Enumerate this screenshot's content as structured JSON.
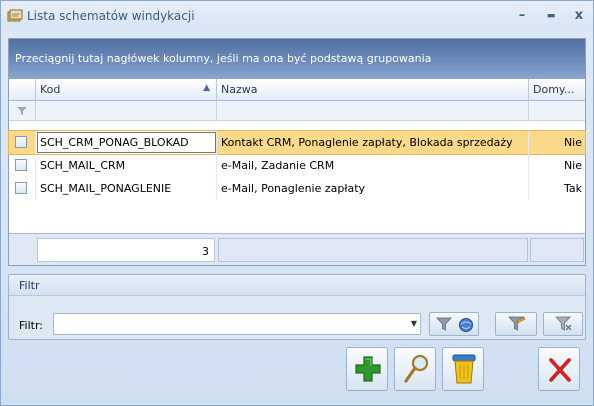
{
  "window": {
    "title": "Lista schematów windykacji",
    "minimize": "–",
    "maximize": "▬",
    "close": "x"
  },
  "grid": {
    "group_hint": "Przeciągnij tutaj nagłówek kolumny, jeśli ma ona być podstawą grupowania",
    "columns": [
      "Kod",
      "Nazwa",
      "Domy..."
    ],
    "sort_indicator": "▲",
    "rows": [
      {
        "kod": "SCH_CRM_PONAG_BLOKAD",
        "nazwa": "Kontakt CRM, Ponaglenie zapłaty, Blokada sprzedaży",
        "domyslny": "Nie",
        "selected": true
      },
      {
        "kod": "SCH_MAIL_CRM",
        "nazwa": "e-Mail, Zadanie CRM",
        "domyslny": "Nie",
        "selected": false
      },
      {
        "kod": "SCH_MAIL_PONAGLENIE",
        "nazwa": "e-Mail, Ponaglenie zapłaty",
        "domyslny": "Tak",
        "selected": false
      }
    ],
    "count": "3"
  },
  "filter": {
    "group_title": "Filtr",
    "label": "Filtr:",
    "value": "",
    "dropdown_icon": "chevron-down-icon"
  },
  "colors": {
    "selected_row": "#fbd98a",
    "group_bar": "#5a7bac",
    "add_green": "#2e9a2e",
    "close_red": "#d81e1e"
  }
}
